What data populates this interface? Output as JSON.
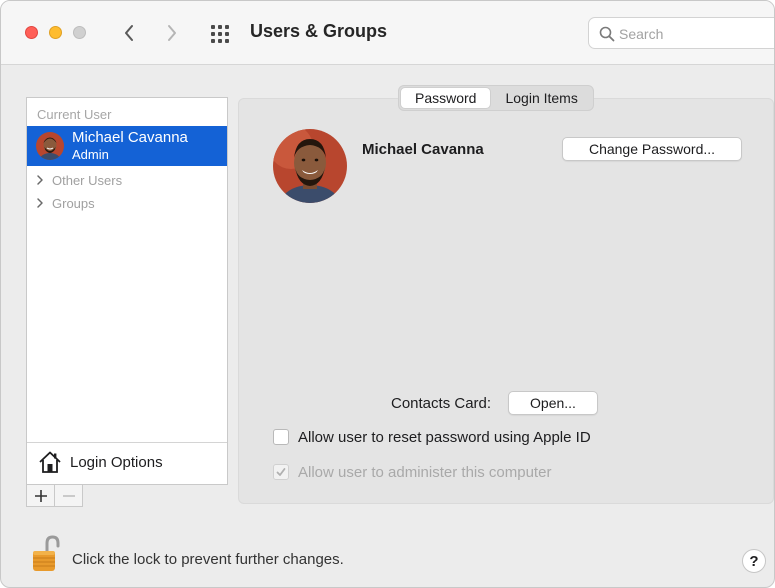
{
  "window": {
    "title": "Users & Groups",
    "search_placeholder": "Search"
  },
  "sidebar": {
    "section_current": "Current User",
    "current_user": {
      "name": "Michael Cavanna",
      "role": "Admin"
    },
    "groups": [
      {
        "label": "Other Users"
      },
      {
        "label": "Groups"
      }
    ],
    "login_options": "Login Options"
  },
  "tabs": [
    {
      "label": "Password",
      "active": true
    },
    {
      "label": "Login Items",
      "active": false
    }
  ],
  "profile": {
    "name": "Michael Cavanna",
    "change_password_label": "Change Password...",
    "contacts_card_label": "Contacts Card:",
    "open_label": "Open..."
  },
  "options": {
    "reset_with_apple_id": {
      "label": "Allow user to reset password using Apple ID",
      "checked": false,
      "enabled": true
    },
    "administer": {
      "label": "Allow user to administer this computer",
      "checked": true,
      "enabled": false
    }
  },
  "footer": {
    "lock_text": "Click the lock to prevent further changes.",
    "help_label": "?"
  },
  "colors": {
    "selection": "#1462d6",
    "close": "#ff5f57",
    "minimize": "#febc2e"
  },
  "icons": [
    "back-chevron-icon",
    "forward-chevron-icon",
    "grid-icon",
    "search-icon",
    "house-icon",
    "lock-icon",
    "checkmark-icon",
    "disclosure-chevron-icon"
  ]
}
